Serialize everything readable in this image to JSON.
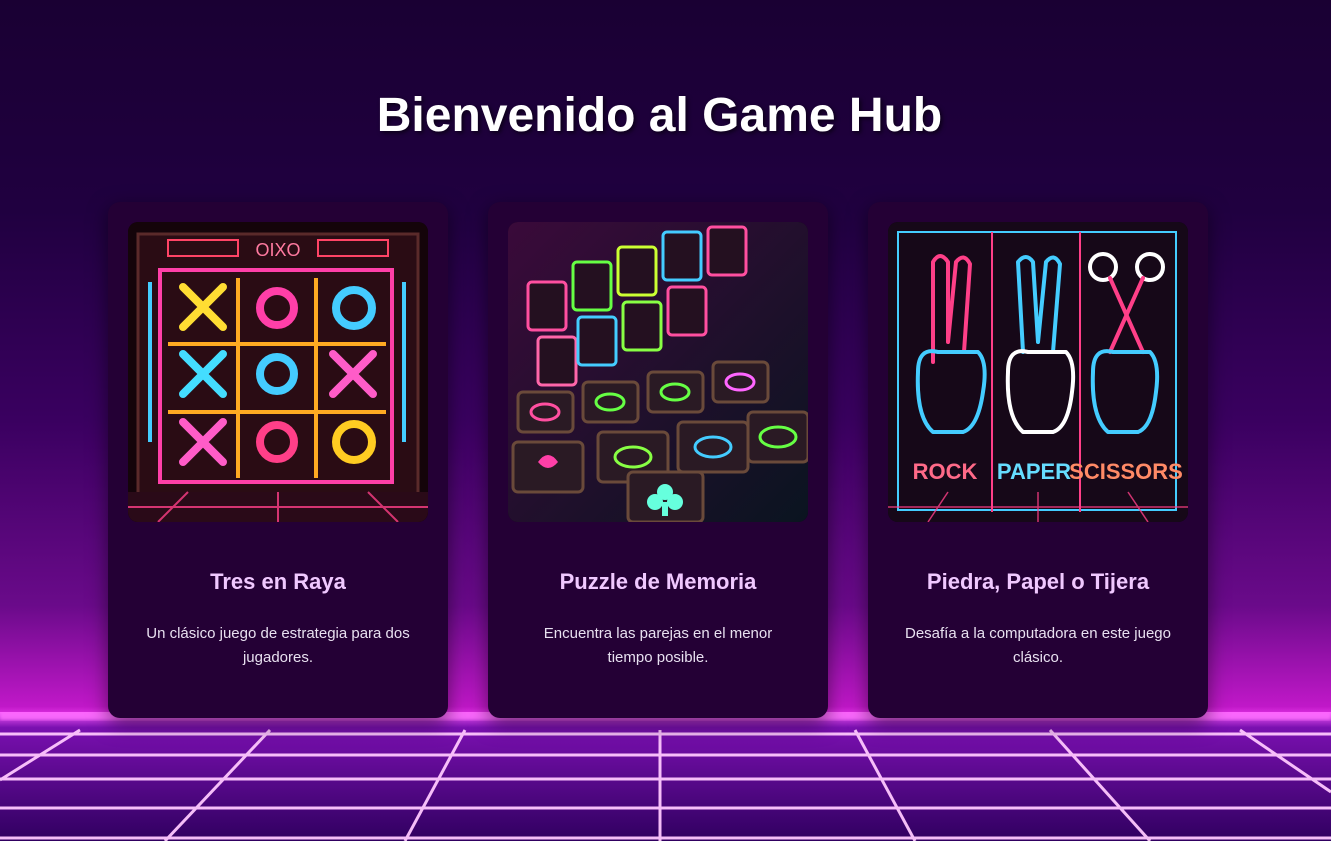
{
  "page": {
    "title": "Bienvenido al Game Hub"
  },
  "colors": {
    "background_top": "#1a0033",
    "background_mid": "#3a0060",
    "neon_pink": "#ff4dff",
    "card_bg": "#240035",
    "card_title": "#f0c8ff",
    "card_text": "#e8e0f0"
  },
  "games": [
    {
      "title": "Tres en Raya",
      "description": "Un clásico juego de estrategia para dos jugadores.",
      "image_icon": "tic-tac-toe-neon-image",
      "image_text": "OIXO"
    },
    {
      "title": "Puzzle de Memoria",
      "description": "Encuentra las parejas en el menor tiempo posible.",
      "image_icon": "memory-cards-neon-image"
    },
    {
      "title": "Piedra, Papel o Tijera",
      "description": "Desafía a la computadora en este juego clásico.",
      "image_icon": "rock-paper-scissors-neon-image",
      "image_labels": [
        "ROCK",
        "PAPER",
        "SCISSORS"
      ]
    }
  ]
}
